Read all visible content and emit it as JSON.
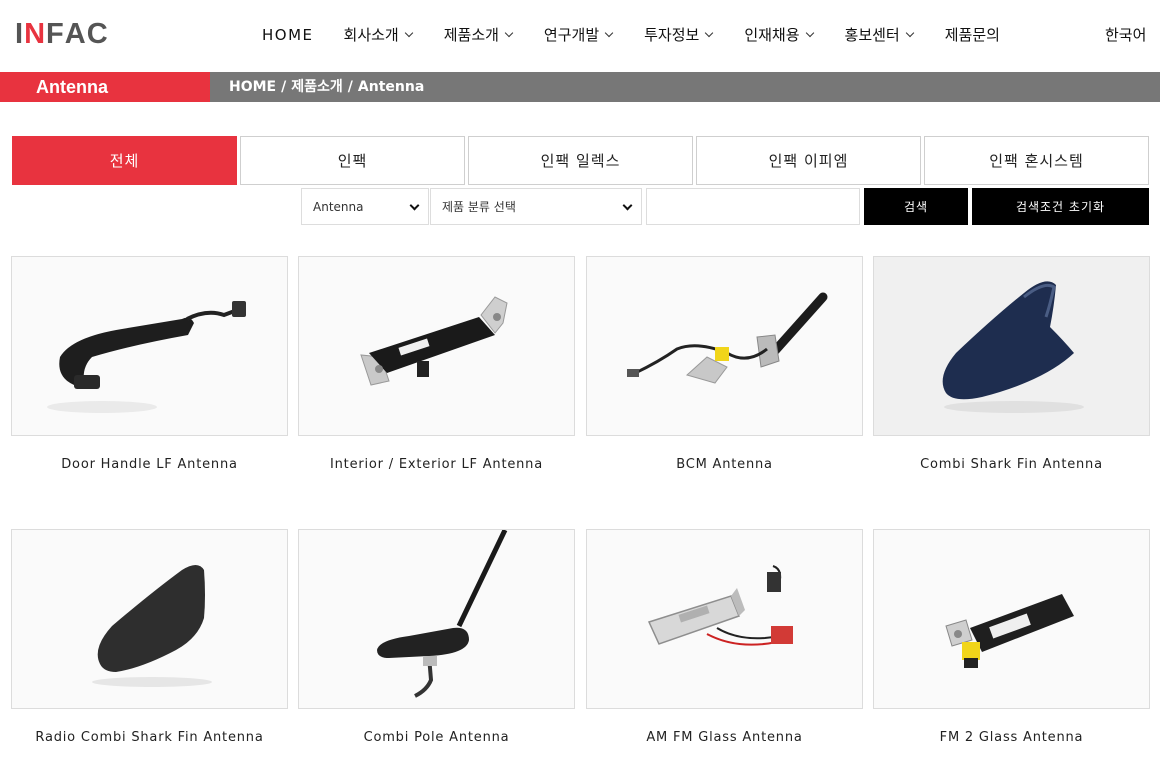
{
  "logo": {
    "letters": [
      "I",
      "N",
      "F",
      "A",
      "C"
    ]
  },
  "nav": {
    "items": [
      {
        "label": "HOME",
        "dropdown": false
      },
      {
        "label": "회사소개",
        "dropdown": true
      },
      {
        "label": "제품소개",
        "dropdown": true
      },
      {
        "label": "연구개발",
        "dropdown": true
      },
      {
        "label": "투자정보",
        "dropdown": true
      },
      {
        "label": "인재채용",
        "dropdown": true
      },
      {
        "label": "홍보센터",
        "dropdown": true
      },
      {
        "label": "제품문의",
        "dropdown": false
      }
    ],
    "language": "한국어"
  },
  "breadcrumb": {
    "title": "Antenna",
    "path": [
      "HOME",
      "제품소개",
      "Antenna"
    ],
    "separator": "/"
  },
  "tabs": [
    {
      "label": "전체",
      "active": true
    },
    {
      "label": "인팩",
      "active": false
    },
    {
      "label": "인팩 일렉스",
      "active": false
    },
    {
      "label": "인팩 이피엠",
      "active": false
    },
    {
      "label": "인팩 혼시스템",
      "active": false
    }
  ],
  "filters": {
    "category_select": "Antenna",
    "subcategory_select": "제품 분류 선택",
    "search_value": "",
    "search_button": "검색",
    "reset_button": "검색조건 초기화"
  },
  "products": [
    {
      "name": "Door Handle LF Antenna",
      "icon": "door-handle-antenna-image"
    },
    {
      "name": "Interior / Exterior LF Antenna",
      "icon": "lf-antenna-module-image"
    },
    {
      "name": "BCM Antenna",
      "icon": "bcm-antenna-image"
    },
    {
      "name": "Combi Shark Fin Antenna",
      "icon": "shark-fin-antenna-image"
    },
    {
      "name": "Radio Combi Shark Fin Antenna",
      "icon": "radio-shark-fin-antenna-image"
    },
    {
      "name": "Combi Pole Antenna",
      "icon": "pole-antenna-image"
    },
    {
      "name": "AM FM Glass Antenna",
      "icon": "am-fm-glass-antenna-image"
    },
    {
      "name": "FM 2 Glass Antenna",
      "icon": "fm2-glass-antenna-image"
    }
  ],
  "colors": {
    "accent": "#e8333f",
    "breadcrumb_bar": "#777777",
    "button": "#000000",
    "shark_fin_blue": "#1e2d4f"
  }
}
